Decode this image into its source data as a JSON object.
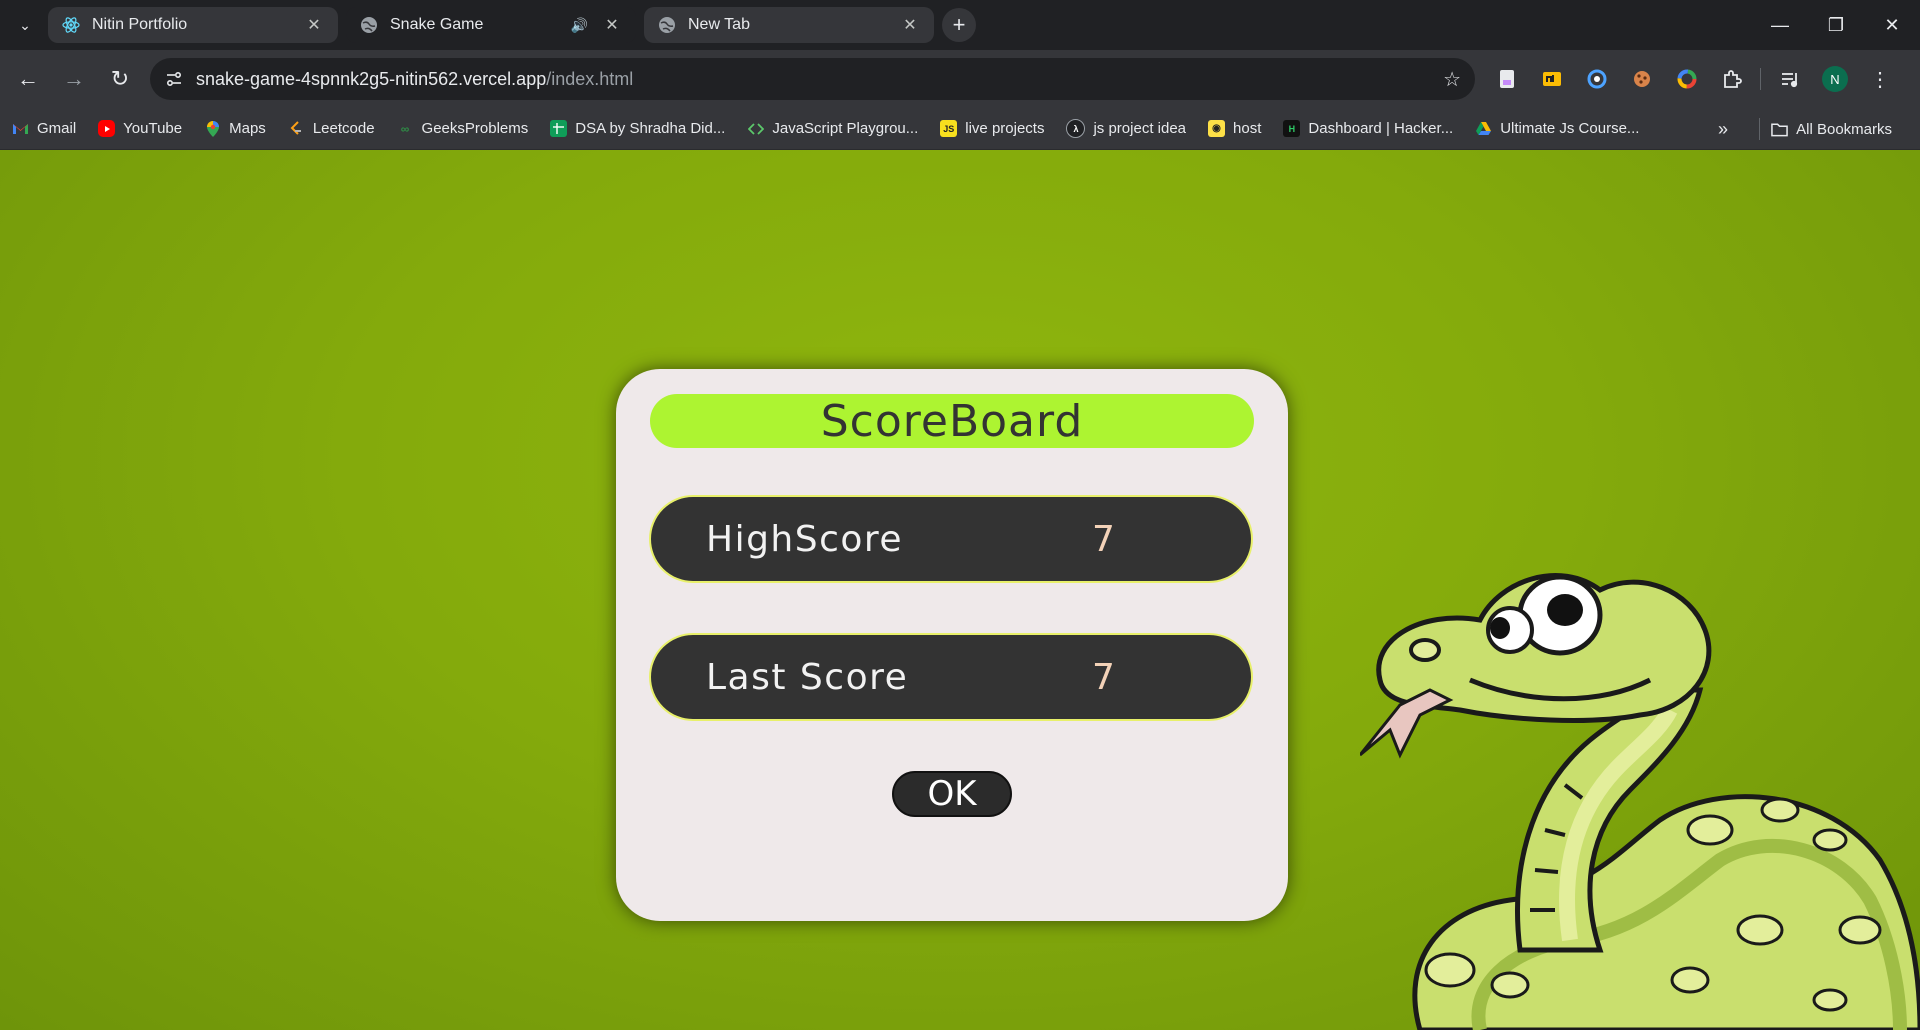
{
  "browser": {
    "tabs": [
      {
        "title": "Nitin Portfolio",
        "state": "inactive",
        "icon": "react-icon"
      },
      {
        "title": "Snake Game",
        "state": "active",
        "icon": "globe-icon",
        "audio": true
      },
      {
        "title": "New Tab",
        "state": "inactive",
        "icon": "globe-icon"
      }
    ],
    "url": {
      "host": "snake-game-4spnnk2g5-nitin562.vercel.app",
      "path": "/index.html"
    },
    "bookmarks": [
      {
        "label": "Gmail",
        "icon": "gmail-icon"
      },
      {
        "label": "YouTube",
        "icon": "youtube-icon"
      },
      {
        "label": "Maps",
        "icon": "maps-icon"
      },
      {
        "label": "Leetcode",
        "icon": "leetcode-icon"
      },
      {
        "label": "GeeksProblems",
        "icon": "geeksforgeeks-icon"
      },
      {
        "label": "DSA by Shradha Did...",
        "icon": "sheets-icon"
      },
      {
        "label": "JavaScript Playgrou...",
        "icon": "code-icon"
      },
      {
        "label": "live projects",
        "icon": "js-icon"
      },
      {
        "label": "js project idea",
        "icon": "lambda-icon"
      },
      {
        "label": "host",
        "icon": "host-icon"
      },
      {
        "label": "Dashboard | Hacker...",
        "icon": "hackerrank-icon"
      },
      {
        "label": "Ultimate Js Course...",
        "icon": "drive-icon"
      }
    ],
    "all_bookmarks_label": "All Bookmarks",
    "profile_initial": "N"
  },
  "game": {
    "scoreboard": {
      "title": "ScoreBoard",
      "high_score_label": "HighScore",
      "high_score_value": "7",
      "last_score_label": "Last Score",
      "last_score_value": "7",
      "ok_label": "OK"
    },
    "colors": {
      "background": "#84aa0c",
      "title_bar": "#adf431",
      "row_bg": "#333333",
      "modal_bg": "#efe9ea"
    }
  }
}
